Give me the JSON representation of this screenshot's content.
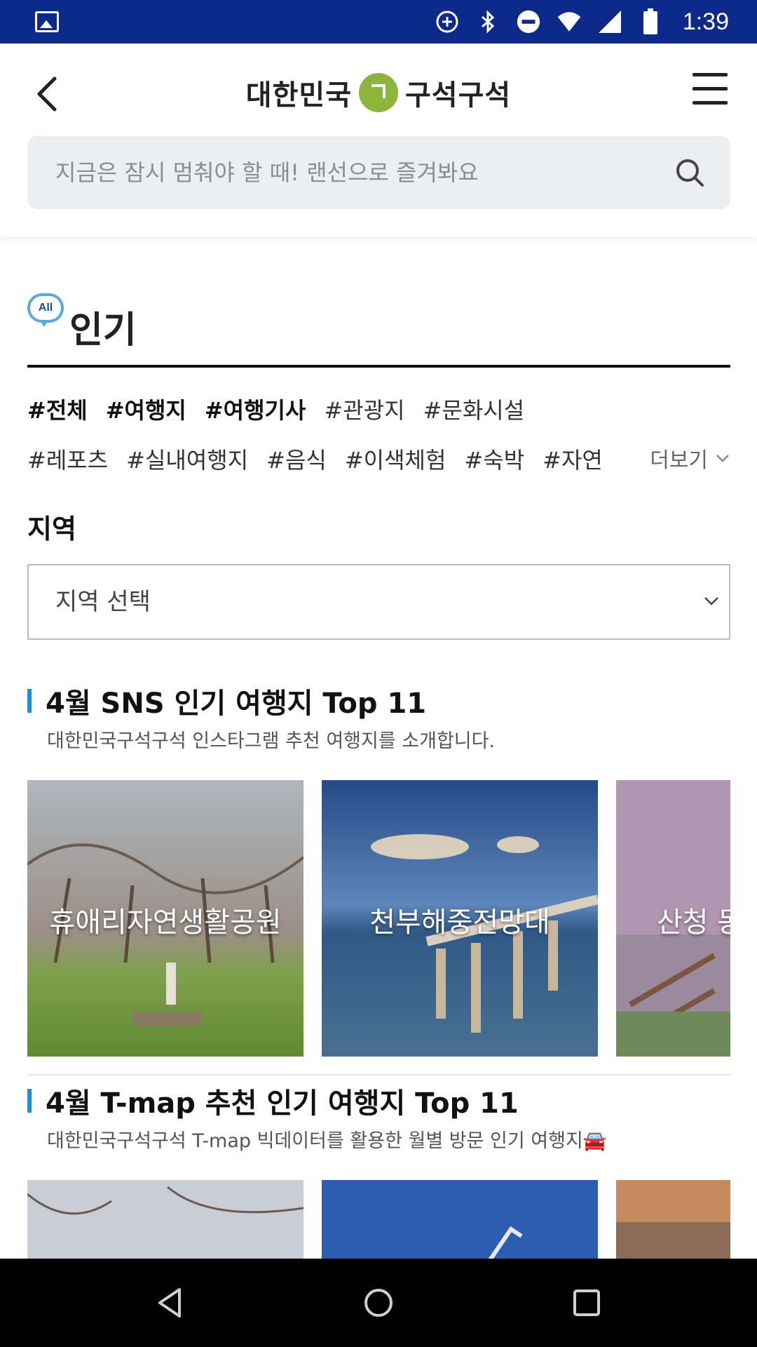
{
  "status_bar": {
    "time": "1:39",
    "icons": [
      "gallery-icon",
      "data-saver-icon",
      "bluetooth-icon",
      "do-not-disturb-icon",
      "wifi-icon",
      "signal-icon",
      "battery-icon"
    ]
  },
  "header": {
    "logo_left": "대한민국",
    "logo_right": "구석구석",
    "search_placeholder": "지금은 잠시 멈춰야 할 때! 랜선으로 즐겨봐요"
  },
  "popular": {
    "badge": "All",
    "title": "인기",
    "tags_row1": [
      {
        "label": "#전체",
        "bold": true
      },
      {
        "label": "#여행지",
        "bold": true
      },
      {
        "label": "#여행기사",
        "bold": true
      },
      {
        "label": "#관광지",
        "bold": false
      },
      {
        "label": "#문화시설",
        "bold": false
      }
    ],
    "tags_row2": [
      {
        "label": "#레포츠",
        "bold": false
      },
      {
        "label": "#실내여행지",
        "bold": false
      },
      {
        "label": "#음식",
        "bold": false
      },
      {
        "label": "#이색체험",
        "bold": false
      },
      {
        "label": "#숙박",
        "bold": false
      },
      {
        "label": "#자연",
        "bold": false
      }
    ],
    "more_label": "더보기"
  },
  "region": {
    "label": "지역",
    "select_value": "지역 선택"
  },
  "sections": [
    {
      "title": "4월 SNS 인기 여행지 Top 11",
      "subtitle": "대한민국구석구석 인스타그램 추천 여행지를 소개합니다.",
      "cards": [
        "휴애리자연생활공원",
        "천부해중전망대",
        "산청 동"
      ]
    },
    {
      "title": "4월 T-map 추천 인기 여행지 Top 11",
      "subtitle": "대한민국구석구석 T-map 빅데이터를 활용한 월별 방문 인기 여행지🚘",
      "cards": [
        "",
        "",
        ""
      ]
    }
  ],
  "colors": {
    "status_bar": "#0d2a8a",
    "logo_green": "#8bb63b",
    "accent_blue": "#1a8fd9",
    "search_bg": "#eceef1"
  }
}
